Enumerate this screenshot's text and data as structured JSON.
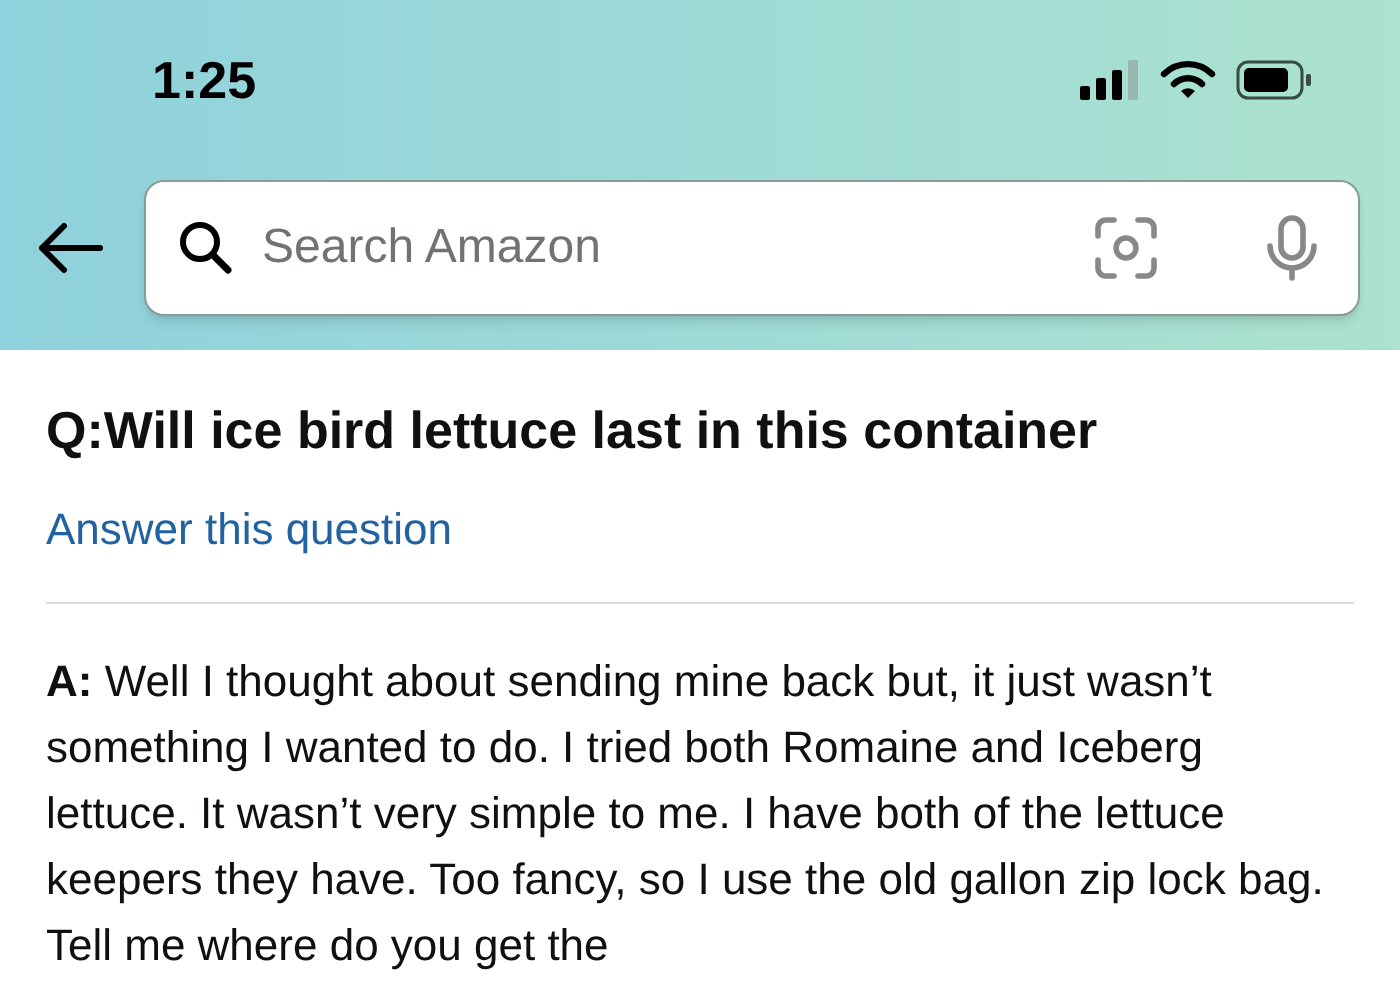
{
  "status_bar": {
    "time": "1:25"
  },
  "search": {
    "placeholder": "Search Amazon"
  },
  "question": {
    "text": "Q:Will ice bird lettuce last in this container",
    "link": "Answer this question"
  },
  "answer": {
    "text": "**A:** Well I thought about sending mine back but, it just wasn’t something I wanted to do. I tried both Romaine and Iceberg lettuce. It wasn’t very simple to me. I have both of the lettuce keepers they have. Too fancy, so I use the old gallon zip lock bag. Tell me where do you get the"
  }
}
